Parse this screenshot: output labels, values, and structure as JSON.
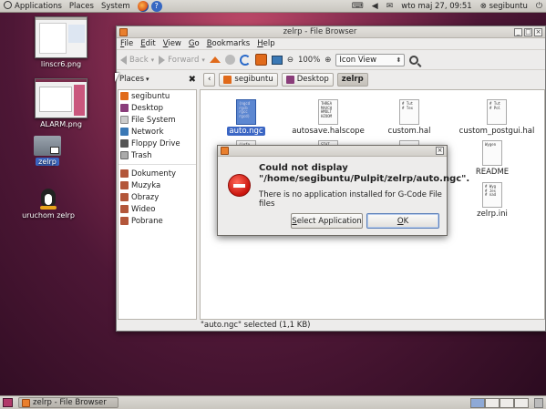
{
  "top_panel": {
    "menus": [
      "Applications",
      "Places",
      "System"
    ],
    "datetime": "wto maj 27, 09:51",
    "user": "segibuntu",
    "tray_icons": [
      "keyboard-icon",
      "sound-icon",
      "mail-icon"
    ]
  },
  "desktop": {
    "icons": [
      {
        "label": "linscr6.png"
      },
      {
        "label": "ALARM.png"
      },
      {
        "label": "zelrp"
      },
      {
        "label": "uruchom zelrp"
      }
    ]
  },
  "window": {
    "title": "zelrp - File Browser",
    "menus": [
      "File",
      "Edit",
      "View",
      "Go",
      "Bookmarks",
      "Help"
    ],
    "toolbar": {
      "back": "Back",
      "forward": "Forward",
      "zoom": "100%",
      "view_mode": "Icon View"
    },
    "places_label": "Places",
    "path": [
      "segibuntu",
      "Desktop",
      "zelrp"
    ],
    "sidebar": {
      "items": [
        "segibuntu",
        "Desktop",
        "File System",
        "Network",
        "Floppy Drive",
        "Trash"
      ],
      "bookmarks": [
        "Dokumenty",
        "Muzyka",
        "Obrazy",
        "Wideo",
        "Pobrane"
      ]
    },
    "files": [
      {
        "name": "auto.ngc",
        "preview": "(ngcd\nrgcb\nrgcc\nrgcd)"
      },
      {
        "name": "autosave.halscope",
        "preview": "THREA\nMAXCH\nHMULT\nHZOOM"
      },
      {
        "name": "custom.hal",
        "preview": "# Tut\n# Tex"
      },
      {
        "name": "custom_postgui.hal",
        "preview": "# Tut\n# Pol"
      },
      {
        "name": "README",
        "preview": "Wygen"
      },
      {
        "name": "zelrp.ini",
        "preview": "# Wyg\n# Jes\n# nad"
      }
    ],
    "partial_files": [
      {
        "preview": "(info\nINI_"
      },
      {
        "preview": "STAT"
      },
      {
        "preview": ""
      }
    ],
    "status": "\"auto.ngc\" selected (1,1 KB)"
  },
  "dialog": {
    "heading": "Could not display \"/home/segibuntu/Pulpit/zelrp/auto.ngc\".",
    "message": "There is no application installed for G-Code File files",
    "buttons": {
      "select": "Select Application",
      "ok": "OK"
    }
  },
  "bottom_panel": {
    "task": "zelrp - File Browser"
  },
  "colors": {
    "selection": "#3b66c4",
    "home_icon": "#e06a1b",
    "error": "#c9140d"
  }
}
